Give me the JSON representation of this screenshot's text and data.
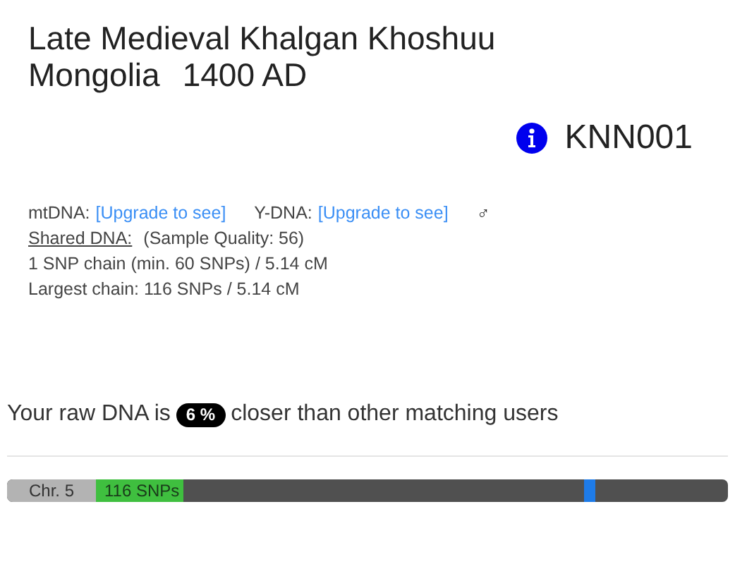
{
  "title": {
    "line_1": "Late Medieval Khalgan Khoshuu",
    "place": "Mongolia",
    "date": "1400 AD"
  },
  "sample_id": "KNN001",
  "haplogroups": [
    {
      "label": "mtDNA:",
      "link": "[Upgrade to see]"
    },
    {
      "label": "Y-DNA:",
      "link": "[Upgrade to see]"
    }
  ],
  "sex_symbol": "♂",
  "shared_dna": {
    "label": "Shared DNA:",
    "quality": "(Sample Quality: 56)",
    "chains": "1 SNP chain (min. 60 SNPs) / 5.14 cM",
    "largest": "Largest chain: 116 SNPs / 5.14 cM"
  },
  "closeness": {
    "before": "Your raw DNA is",
    "badge": "6 %",
    "after": "closer than other matching users"
  },
  "chromosome": {
    "label": "Chr. 5",
    "snps": "116 SNPs"
  }
}
